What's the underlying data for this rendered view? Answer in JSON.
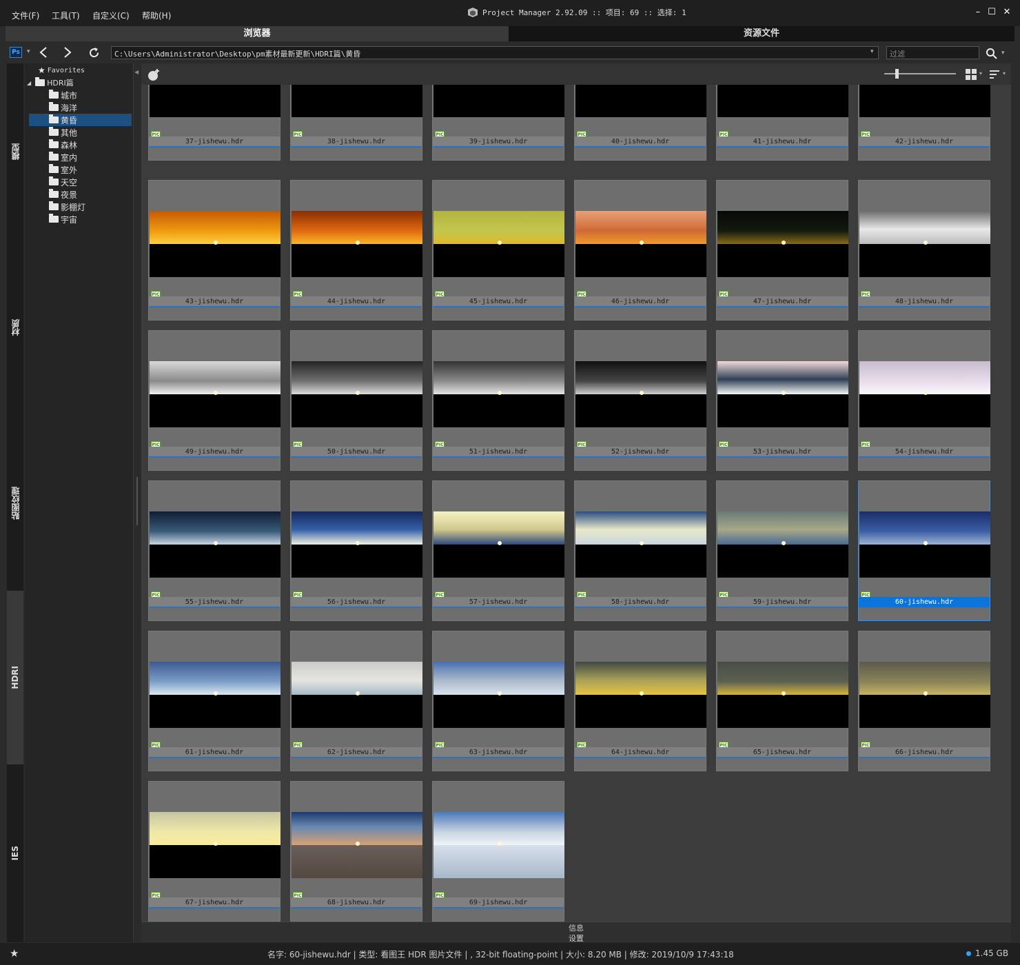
{
  "menu": [
    "文件(F)",
    "工具(T)",
    "自定义(C)",
    "帮助(H)"
  ],
  "title": "Project Manager 2.92.09  :: 项目: 69  :: 选择: 1",
  "window_controls": [
    "–",
    "☐",
    "✕"
  ],
  "tabs": [
    "浏览器",
    "资源文件"
  ],
  "address": {
    "app_icon": "Ps",
    "path": "C:\\Users\\Administrator\\Desktop\\pm素材最新更新\\HDRI篇\\黄昏",
    "filter_placeholder": "过滤"
  },
  "vertical_tabs": [
    "模型",
    "材质",
    "贴图纹理",
    "HDRI",
    "IES"
  ],
  "tree": {
    "favorites": "Favorites",
    "root": "HDRI篇",
    "selected": "黄昏",
    "children": [
      "城市",
      "海洋",
      "黄昏",
      "其他",
      "森林",
      "室内",
      "室外",
      "天空",
      "夜景",
      "影棚灯",
      "宇宙"
    ]
  },
  "files": [
    {
      "name": "37-jishewu.hdr",
      "sky": "linear-gradient(#9fd1cf,#6fa7a5)"
    },
    {
      "name": "38-jishewu.hdr",
      "sky": "linear-gradient(#f0a21a,#c85a05)"
    },
    {
      "name": "39-jishewu.hdr",
      "sky": "linear-gradient(#f0a21a,#c85a05)"
    },
    {
      "name": "40-jishewu.hdr",
      "sky": "linear-gradient(#f0a21a,#c85a05)"
    },
    {
      "name": "41-jishewu.hdr",
      "sky": "linear-gradient(#f0a21a,#c85a05)"
    },
    {
      "name": "42-jishewu.hdr",
      "sky": "linear-gradient(#f0a21a,#c85a05)"
    },
    {
      "name": "43-jishewu.hdr",
      "sky": "linear-gradient(#c45a05,#ef9a10 60%,#fcd040)"
    },
    {
      "name": "44-jishewu.hdr",
      "sky": "linear-gradient(#8a2e02,#e06a10 60%,#f8b52a)"
    },
    {
      "name": "45-jishewu.hdr",
      "sky": "linear-gradient(#b4b440,#c2c64e 60%,#e0b82c)"
    },
    {
      "name": "46-jishewu.hdr",
      "sky": "linear-gradient(#e8a078,#d06a35 60%,#f09a2a)"
    },
    {
      "name": "47-jishewu.hdr",
      "sky": "linear-gradient(#070907,#121a0d 60%,#8a6a18)"
    },
    {
      "name": "48-jishewu.hdr",
      "sky": "linear-gradient(#6c6c6c,#e8e8e8 55%,#bcbcbc)"
    },
    {
      "name": "49-jishewu.hdr",
      "sky": "linear-gradient(#d9d9d9,#8a8a8a 60%,#f0f0f0)"
    },
    {
      "name": "50-jishewu.hdr",
      "sky": "linear-gradient(#242424,#707070 60%,#dcdcdc)"
    },
    {
      "name": "51-jishewu.hdr",
      "sky": "linear-gradient(#333,#8a8a8a 60%,#e5e5e5)"
    },
    {
      "name": "52-jishewu.hdr",
      "sky": "linear-gradient(#111,#454545 60%,#cfcfcf)"
    },
    {
      "name": "53-jishewu.hdr",
      "sky": "linear-gradient(#f0dada,#2f4055 55%,#f5f5f5)"
    },
    {
      "name": "54-jishewu.hdr",
      "sky": "linear-gradient(#c6bccc,#e8dcec 60%,#fafafa)"
    },
    {
      "name": "55-jishewu.hdr",
      "sky": "linear-gradient(#0f1e35,#3a5a7a 60%,#c8d6e0)"
    },
    {
      "name": "56-jishewu.hdr",
      "sky": "linear-gradient(#14285c,#3560a8 55%,#f2f2e0)"
    },
    {
      "name": "57-jishewu.hdr",
      "sky": "linear-gradient(#f6f2c4,#cfc88c 55%,#2d4a82)"
    },
    {
      "name": "58-jishewu.hdr",
      "sky": "linear-gradient(#2c4d82,#e8e8c8 55%,#c8d6e0)"
    },
    {
      "name": "59-jishewu.hdr",
      "sky": "linear-gradient(#6a7a78,#a8a888 55%,#4a6a95)"
    },
    {
      "name": "60-jishewu.hdr",
      "sky": "linear-gradient(#1a2d6a,#3c5ea5 60%,#9cb4d0)"
    },
    {
      "name": "61-jishewu.hdr",
      "sky": "linear-gradient(#3d5a92,#7d9dc8 60%,#dce8f0)"
    },
    {
      "name": "62-jishewu.hdr",
      "sky": "linear-gradient(#cacaca,#e6e6e0 55%,#a7bac6)"
    },
    {
      "name": "63-jishewu.hdr",
      "sky": "linear-gradient(#4a6fb0,#a8b8c8 55%,#d8e4ee)"
    },
    {
      "name": "64-jishewu.hdr",
      "sky": "linear-gradient(#3e4842,#a8a058 55%,#e8c440)"
    },
    {
      "name": "65-jishewu.hdr",
      "sky": "linear-gradient(#484c46,#5c6050 60%,#d8b436)"
    },
    {
      "name": "66-jishewu.hdr",
      "sky": "linear-gradient(#5c5a4c,#8a8258 60%,#c8b460)"
    },
    {
      "name": "67-jishewu.hdr",
      "sky": "linear-gradient(#c6c6a0,#f0e8a8 60%,#f8ec9c)"
    },
    {
      "name": "68-jishewu.hdr",
      "sky": "linear-gradient(#1a3a70,#6a88b0 45%,#d8a070)",
      "ground": "linear-gradient(#6a5e58,#544842)"
    },
    {
      "name": "69-jishewu.hdr",
      "sky": "linear-gradient(#4d7ab8,#c8d4e0 60%,#f0f4f8)",
      "ground": "linear-gradient(#d8e0ea,#a8b8cc)"
    }
  ],
  "selected_file": "60-jishewu.hdr",
  "pic_badge": "PIC",
  "bottom_tabs": [
    "信息",
    "设置"
  ],
  "status": "名字: 60-jishewu.hdr | 类型: 看图王 HDR 图片文件 | , 32-bit floating-point | 大小: 8.20 MB | 修改: 2019/10/9 17:43:18",
  "disk": "1.45 GB",
  "accent": "#0a74da"
}
